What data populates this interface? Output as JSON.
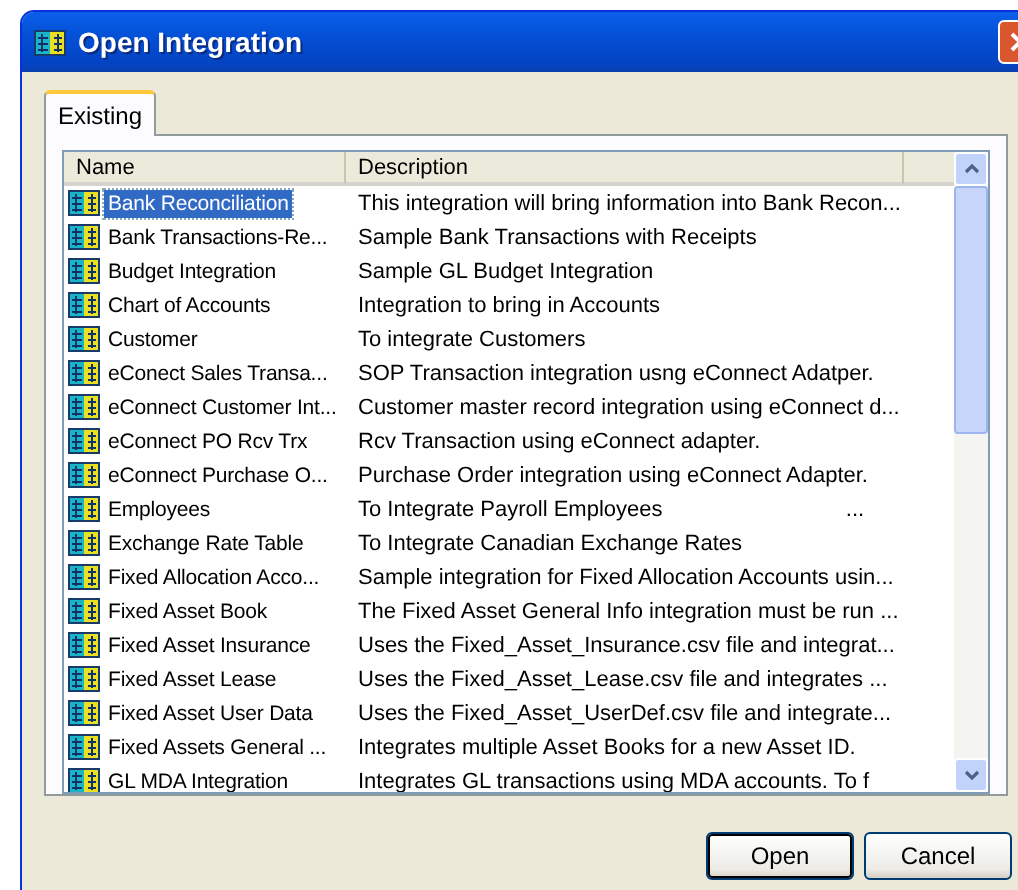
{
  "window": {
    "title": "Open Integration"
  },
  "tabs": [
    {
      "label": "Existing",
      "selected": true
    }
  ],
  "table": {
    "columns": [
      "Name",
      "Description"
    ],
    "rows": [
      {
        "name": "Bank Reconciliation",
        "description": "This integration will bring information into Bank Recon...",
        "selected": true
      },
      {
        "name": "Bank Transactions-Re...",
        "description": "Sample Bank Transactions with Receipts",
        "selected": false
      },
      {
        "name": "Budget Integration",
        "description": "Sample GL Budget Integration",
        "selected": false
      },
      {
        "name": "Chart of Accounts",
        "description": "Integration to bring in Accounts",
        "selected": false
      },
      {
        "name": "Customer",
        "description": "To integrate Customers",
        "selected": false
      },
      {
        "name": "eConect Sales Transa...",
        "description": "SOP Transaction integration usng eConnect Adatper.",
        "selected": false
      },
      {
        "name": "eConnect Customer Int...",
        "description": "Customer master record integration using eConnect d...",
        "selected": false
      },
      {
        "name": "eConnect PO Rcv Trx",
        "description": "Rcv Transaction using eConnect adapter.",
        "selected": false
      },
      {
        "name": "eConnect Purchase O...",
        "description": "Purchase Order integration using eConnect Adapter.",
        "selected": false
      },
      {
        "name": "Employees",
        "description": "To Integrate Payroll Employees                              ...",
        "selected": false
      },
      {
        "name": "Exchange Rate Table",
        "description": "To Integrate Canadian Exchange Rates",
        "selected": false
      },
      {
        "name": "Fixed Allocation Acco...",
        "description": "Sample integration for Fixed Allocation Accounts usin...",
        "selected": false
      },
      {
        "name": "Fixed Asset Book",
        "description": "The Fixed Asset General Info integration must be run ...",
        "selected": false
      },
      {
        "name": "Fixed Asset Insurance",
        "description": "Uses the Fixed_Asset_Insurance.csv file and integrat...",
        "selected": false
      },
      {
        "name": "Fixed Asset Lease",
        "description": "Uses the Fixed_Asset_Lease.csv file and integrates ...",
        "selected": false
      },
      {
        "name": "Fixed Asset User Data",
        "description": "Uses the Fixed_Asset_UserDef.csv file and integrate...",
        "selected": false
      },
      {
        "name": "Fixed Assets General ...",
        "description": "Integrates multiple Asset Books for a new Asset ID.",
        "selected": false
      },
      {
        "name": "GL MDA Integration",
        "description": "Integrates GL transactions using MDA accounts. To f",
        "selected": false
      }
    ]
  },
  "buttons": [
    "Open",
    "Cancel"
  ]
}
